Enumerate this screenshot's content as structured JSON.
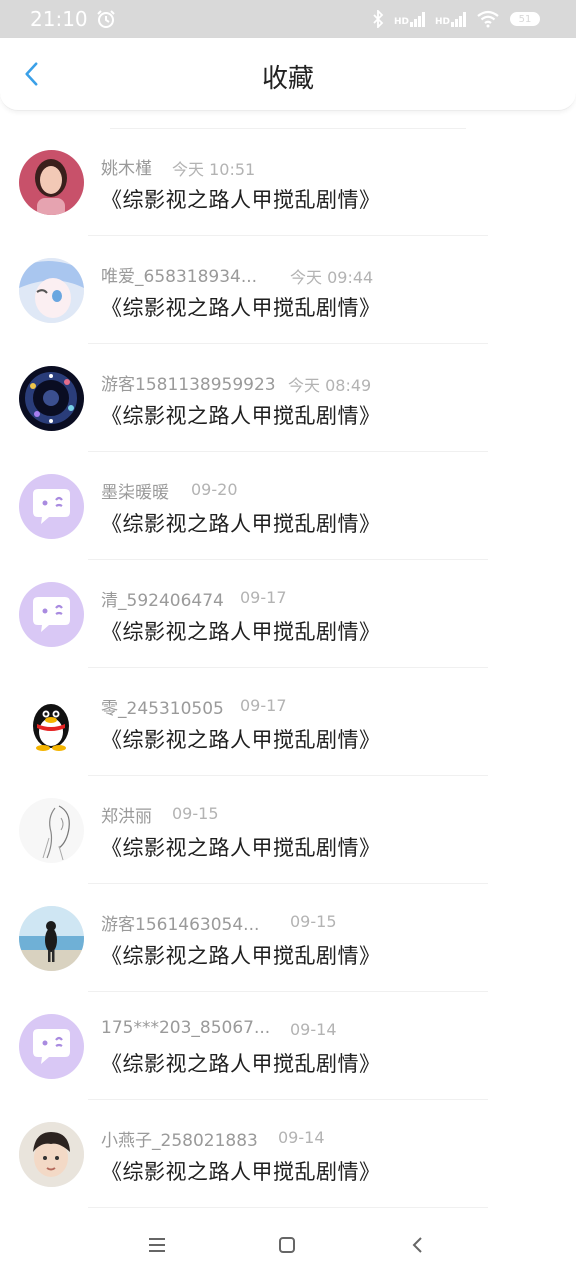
{
  "status_bar": {
    "time": "21:10",
    "network_1": "HD",
    "network_2": "HD",
    "battery": "51"
  },
  "header": {
    "title": "收藏",
    "back_icon": "chevron-left-icon"
  },
  "colors": {
    "accent": "#3aa0e8",
    "default_avatar_bg": "#d9c8f5"
  },
  "favorites": [
    {
      "user": "姚木槿",
      "time": "今天 10:51",
      "book": "《综影视之路人甲搅乱剧情》",
      "avatar": "photo-avatar-girl"
    },
    {
      "user": "唯爱_658318934...",
      "time": "今天 09:44",
      "book": "《综影视之路人甲搅乱剧情》",
      "avatar": "anime-avatar"
    },
    {
      "user": "游客1581138959923",
      "time": "今天 08:49",
      "book": "《综影视之路人甲搅乱剧情》",
      "avatar": "galaxy-avatar"
    },
    {
      "user": "墨柒暖暖",
      "time": "09-20",
      "book": "《综影视之路人甲搅乱剧情》",
      "avatar": "default-chat-avatar"
    },
    {
      "user": "清_592406474",
      "time": "09-17",
      "book": "《综影视之路人甲搅乱剧情》",
      "avatar": "default-chat-avatar"
    },
    {
      "user": "零_245310505",
      "time": "09-17",
      "book": "《综影视之路人甲搅乱剧情》",
      "avatar": "penguin-avatar"
    },
    {
      "user": "郑洪丽",
      "time": "09-15",
      "book": "《综影视之路人甲搅乱剧情》",
      "avatar": "sketch-avatar"
    },
    {
      "user": "游客1561463054...",
      "time": "09-15",
      "book": "《综影视之路人甲搅乱剧情》",
      "avatar": "beach-avatar"
    },
    {
      "user": "175***203_85067...",
      "time": "09-14",
      "book": "《综影视之路人甲搅乱剧情》",
      "avatar": "default-chat-avatar"
    },
    {
      "user": "小燕子_258021883",
      "time": "09-14",
      "book": "《综影视之路人甲搅乱剧情》",
      "avatar": "boy-avatar"
    }
  ],
  "nav_bar": {
    "menu_icon": "menu-icon",
    "home_icon": "home-square-icon",
    "back_icon": "back-triangle-icon"
  }
}
